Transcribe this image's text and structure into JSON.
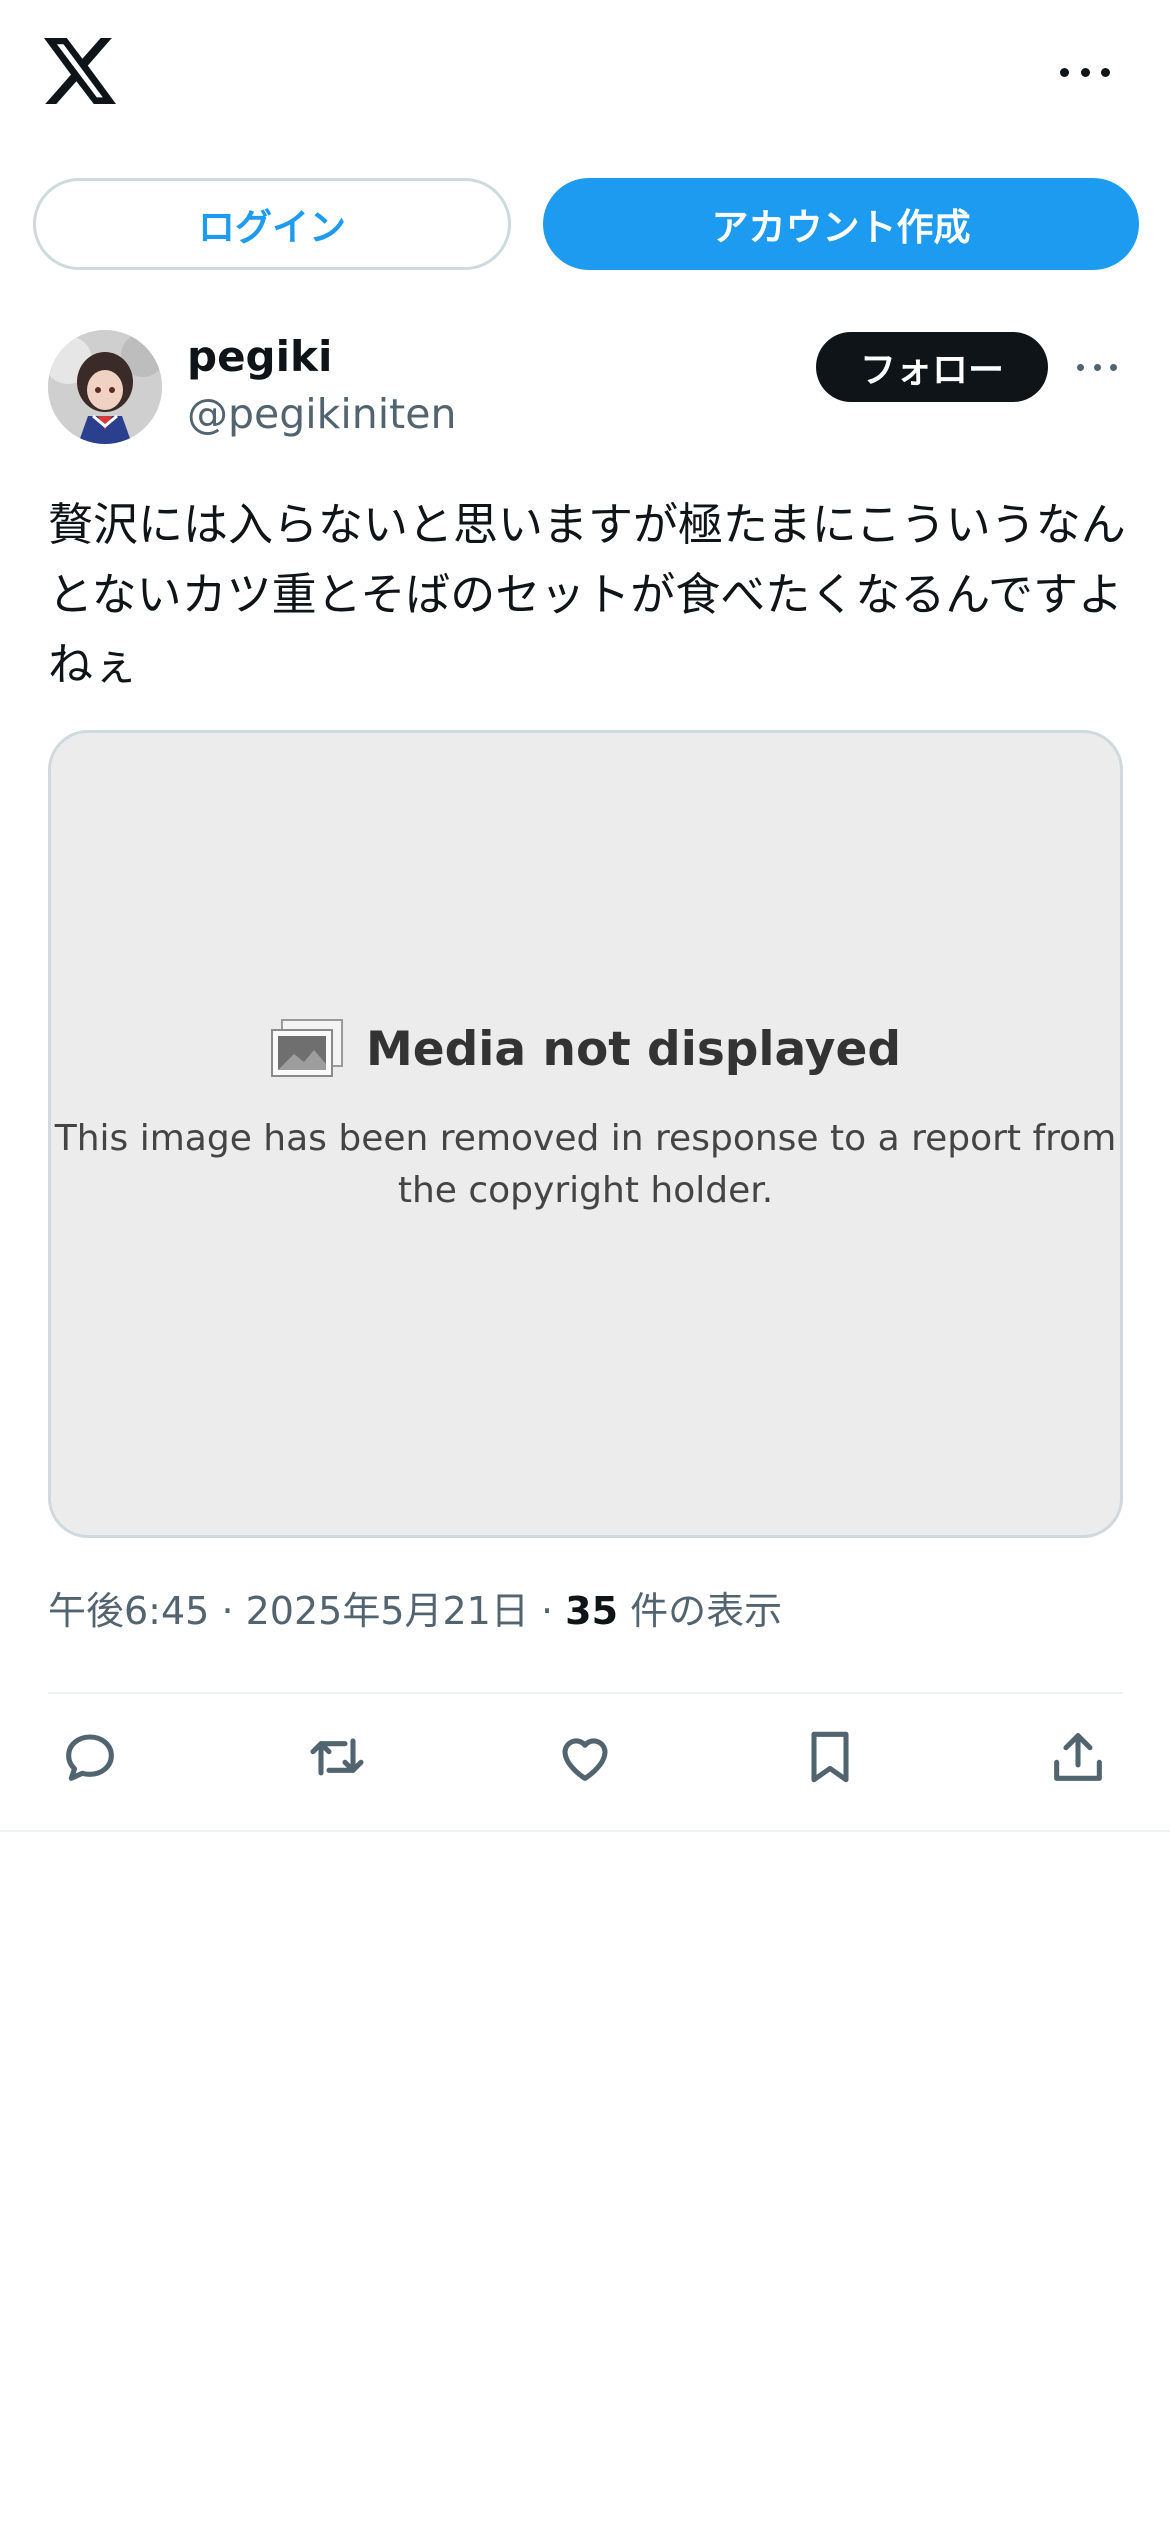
{
  "header": {
    "logo_icon": "x-logo-icon",
    "more_icon": "more-horizontal-icon"
  },
  "auth": {
    "login_label": "ログイン",
    "signup_label": "アカウント作成"
  },
  "tweet": {
    "author": {
      "display_name": "pegiki",
      "handle": "@pegikiniten",
      "avatar_icon": "avatar-icon"
    },
    "follow_label": "フォロー",
    "text": "贅沢には入らないと思いますが極たまにこういうなんとないカツ重とそばのセットが食べたくなるんですよねぇ",
    "media": {
      "title": "Media not displayed",
      "description": "This image has been removed in response to a report from the copyright holder."
    },
    "meta": {
      "time": "午後6:45",
      "separator": "·",
      "date": "2025年5月21日",
      "view_count": "35",
      "view_label": "件の表示"
    },
    "actions": [
      {
        "name": "reply-icon"
      },
      {
        "name": "retweet-icon"
      },
      {
        "name": "like-icon"
      },
      {
        "name": "bookmark-icon"
      },
      {
        "name": "share-icon"
      }
    ]
  },
  "colors": {
    "accent": "#1d9bf0",
    "text_primary": "#0f1419",
    "text_secondary": "#536471",
    "border": "#cfd9de"
  }
}
